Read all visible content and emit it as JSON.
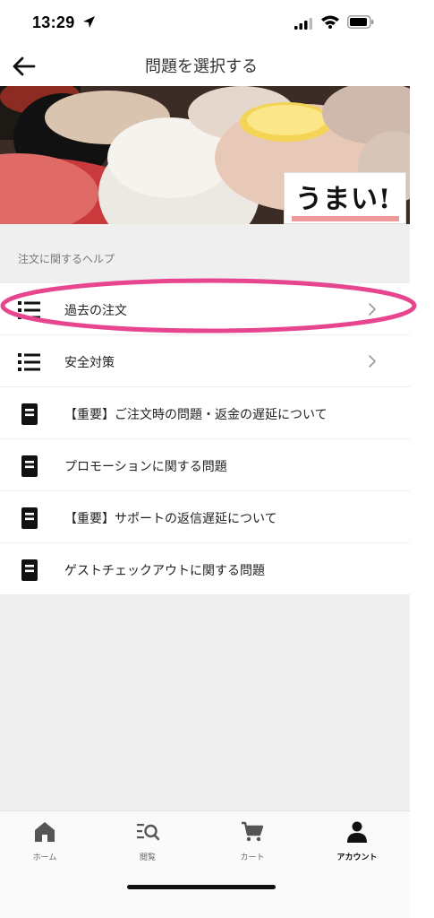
{
  "status_bar": {
    "time": "13:29"
  },
  "header": {
    "title": "問題を選択する"
  },
  "banner": {
    "logo_text": "うまい!"
  },
  "section": {
    "title": "注文に関するヘルプ"
  },
  "help_items": [
    {
      "label": "過去の注文",
      "icon": "list-icon",
      "has_chevron": true
    },
    {
      "label": "安全対策",
      "icon": "list-icon",
      "has_chevron": true
    },
    {
      "label": "【重要】ご注文時の問題・返金の遅延について",
      "icon": "document-icon",
      "has_chevron": false
    },
    {
      "label": "プロモーションに関する問題",
      "icon": "document-icon",
      "has_chevron": false
    },
    {
      "label": "【重要】サポートの返信遅延について",
      "icon": "document-icon",
      "has_chevron": false
    },
    {
      "label": "ゲストチェックアウトに関する問題",
      "icon": "document-icon",
      "has_chevron": false
    }
  ],
  "bottom_nav": {
    "tabs": [
      {
        "label": "ホーム",
        "icon": "home-icon"
      },
      {
        "label": "閲覧",
        "icon": "browse-icon"
      },
      {
        "label": "カート",
        "icon": "cart-icon"
      },
      {
        "label": "アカウント",
        "icon": "account-icon",
        "active": true
      }
    ]
  },
  "colors": {
    "highlight_ring": "#e8458f",
    "background_gray": "#efefef",
    "text_dark": "#222222"
  }
}
